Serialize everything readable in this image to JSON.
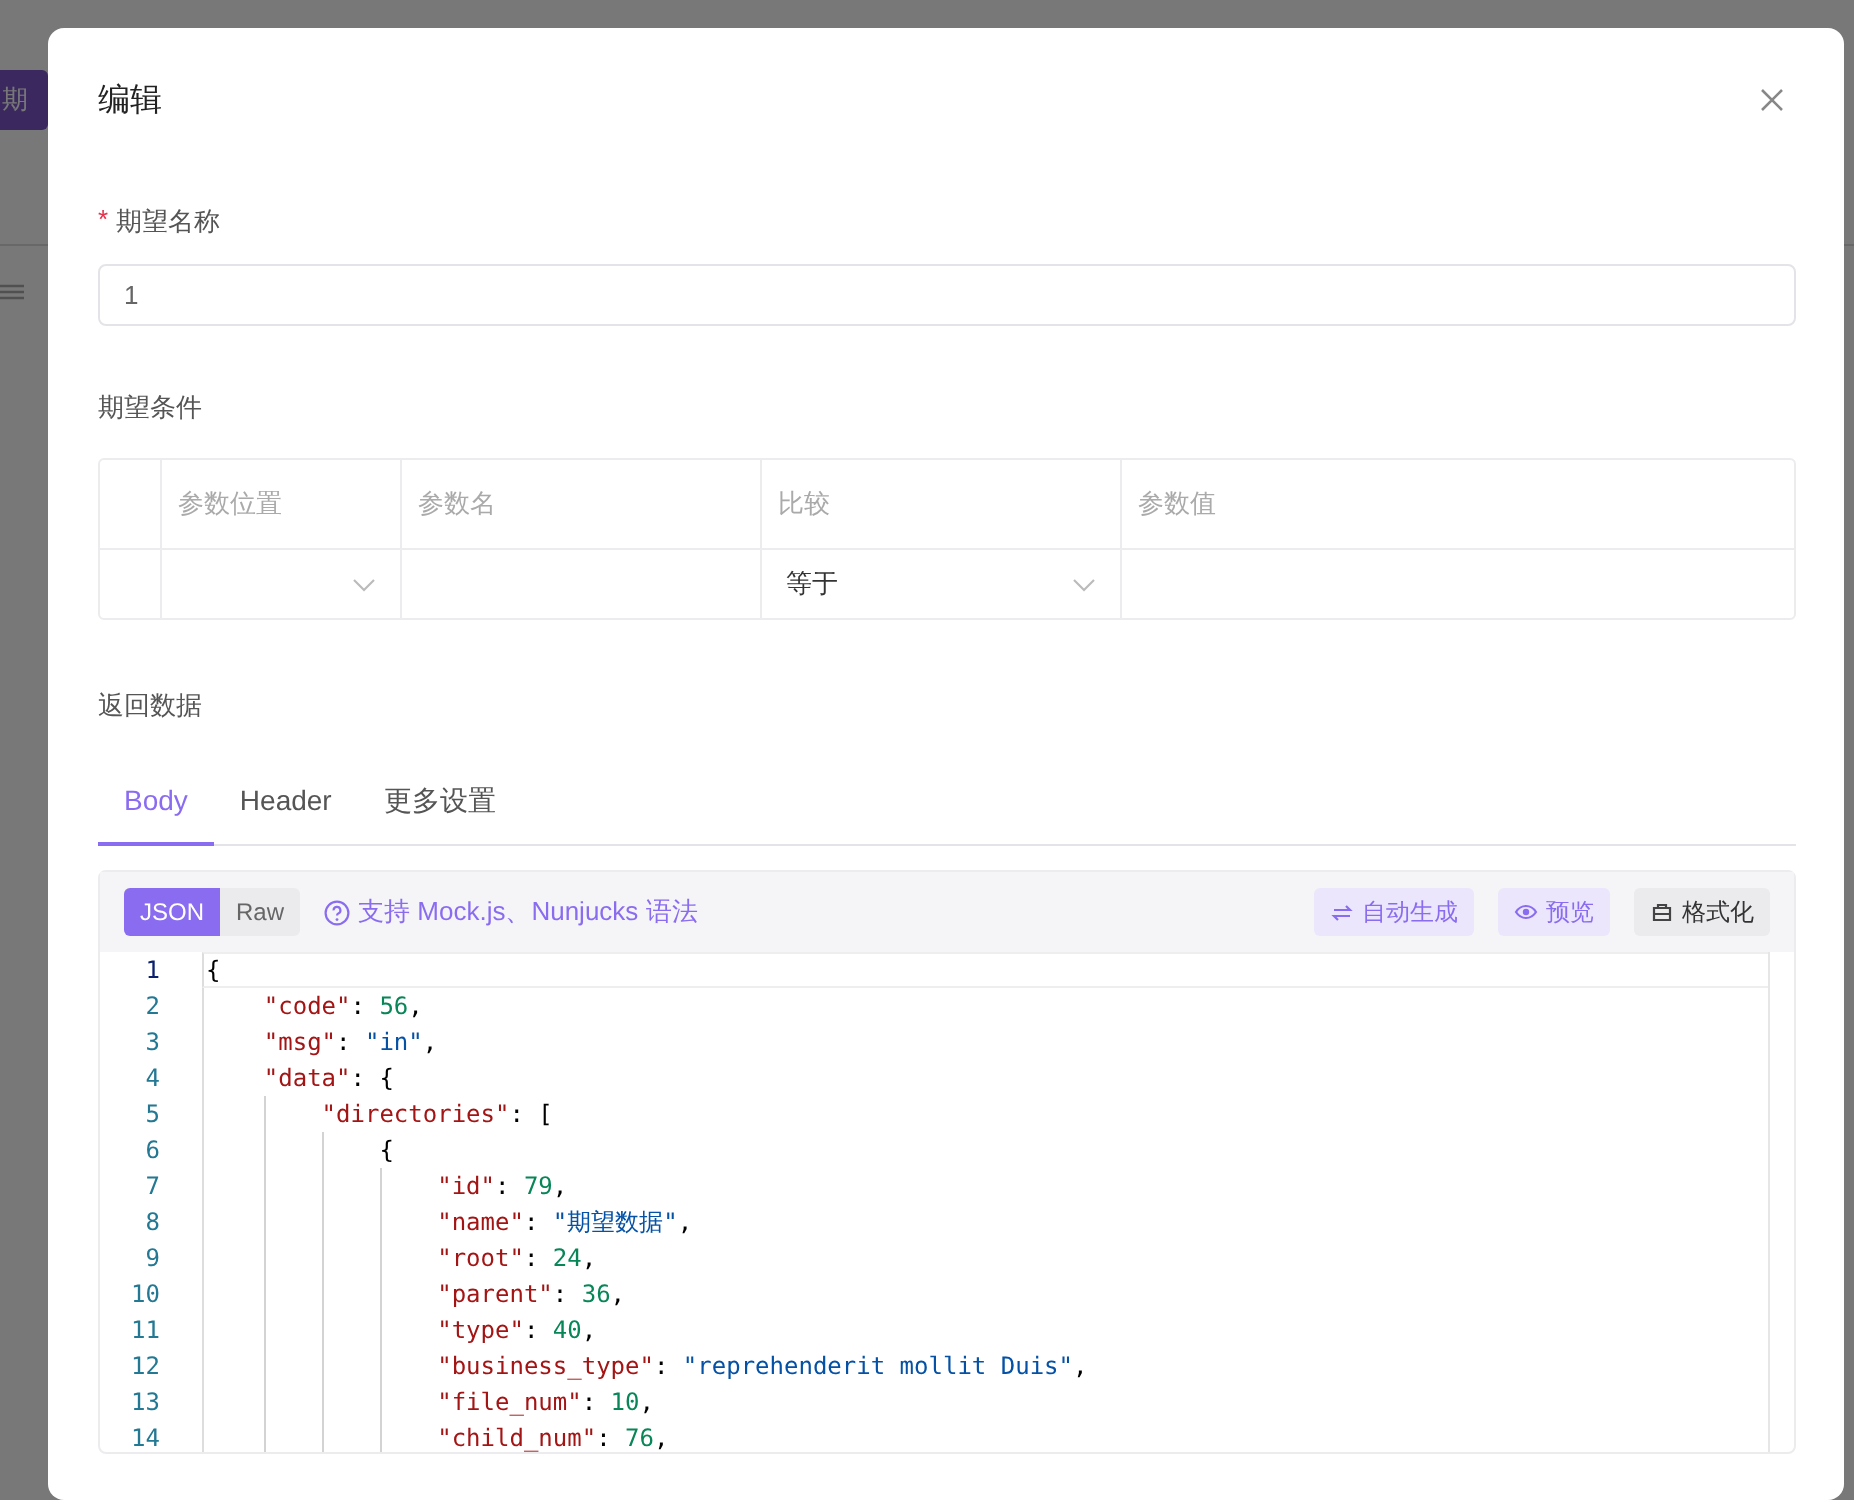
{
  "background": {
    "button_label": "期"
  },
  "dialog": {
    "title": "编辑",
    "name_field": {
      "label": "期望名称",
      "required_mark": "*",
      "value": "1"
    },
    "conditions": {
      "title": "期望条件",
      "columns": [
        "参数位置",
        "参数名",
        "比较",
        "参数值"
      ],
      "rows": [
        {
          "compare": "等于"
        }
      ]
    },
    "response": {
      "title": "返回数据",
      "tabs": [
        {
          "label": "Body",
          "selected": true
        },
        {
          "label": "Header",
          "selected": false
        },
        {
          "label": "更多设置",
          "selected": false
        }
      ],
      "formats": [
        {
          "label": "JSON",
          "selected": true
        },
        {
          "label": "Raw",
          "selected": false
        }
      ],
      "help_link": "支持 Mock.js、Nunjucks 语法",
      "actions": [
        {
          "label": "自动生成",
          "kind": "generate"
        },
        {
          "label": "预览",
          "kind": "preview"
        },
        {
          "label": "格式化",
          "kind": "format"
        }
      ],
      "code_lines": [
        {
          "number": "1",
          "current": true,
          "tokens": [
            {
              "kind": "punct",
              "text": "{"
            }
          ]
        },
        {
          "number": "2",
          "current": false,
          "tokens": [
            {
              "kind": "key",
              "text": "    \"code\""
            },
            {
              "kind": "punct",
              "text": ": "
            },
            {
              "kind": "number",
              "text": "56"
            },
            {
              "kind": "punct",
              "text": ","
            }
          ]
        },
        {
          "number": "3",
          "current": false,
          "tokens": [
            {
              "kind": "key",
              "text": "    \"msg\""
            },
            {
              "kind": "punct",
              "text": ": "
            },
            {
              "kind": "string",
              "text": "\"in\""
            },
            {
              "kind": "punct",
              "text": ","
            }
          ]
        },
        {
          "number": "4",
          "current": false,
          "tokens": [
            {
              "kind": "key",
              "text": "    \"data\""
            },
            {
              "kind": "punct",
              "text": ": {"
            }
          ]
        },
        {
          "number": "5",
          "current": false,
          "tokens": [
            {
              "kind": "key",
              "text": "        \"directories\""
            },
            {
              "kind": "punct",
              "text": ": ["
            }
          ]
        },
        {
          "number": "6",
          "current": false,
          "tokens": [
            {
              "kind": "punct",
              "text": "            {"
            }
          ]
        },
        {
          "number": "7",
          "current": false,
          "tokens": [
            {
              "kind": "key",
              "text": "                \"id\""
            },
            {
              "kind": "punct",
              "text": ": "
            },
            {
              "kind": "number",
              "text": "79"
            },
            {
              "kind": "punct",
              "text": ","
            }
          ]
        },
        {
          "number": "8",
          "current": false,
          "tokens": [
            {
              "kind": "key",
              "text": "                \"name\""
            },
            {
              "kind": "punct",
              "text": ": "
            },
            {
              "kind": "string",
              "text": "\"期望数据\""
            },
            {
              "kind": "punct",
              "text": ","
            }
          ]
        },
        {
          "number": "9",
          "current": false,
          "tokens": [
            {
              "kind": "key",
              "text": "                \"root\""
            },
            {
              "kind": "punct",
              "text": ": "
            },
            {
              "kind": "number",
              "text": "24"
            },
            {
              "kind": "punct",
              "text": ","
            }
          ]
        },
        {
          "number": "10",
          "current": false,
          "tokens": [
            {
              "kind": "key",
              "text": "                \"parent\""
            },
            {
              "kind": "punct",
              "text": ": "
            },
            {
              "kind": "number",
              "text": "36"
            },
            {
              "kind": "punct",
              "text": ","
            }
          ]
        },
        {
          "number": "11",
          "current": false,
          "tokens": [
            {
              "kind": "key",
              "text": "                \"type\""
            },
            {
              "kind": "punct",
              "text": ": "
            },
            {
              "kind": "number",
              "text": "40"
            },
            {
              "kind": "punct",
              "text": ","
            }
          ]
        },
        {
          "number": "12",
          "current": false,
          "tokens": [
            {
              "kind": "key",
              "text": "                \"business_type\""
            },
            {
              "kind": "punct",
              "text": ": "
            },
            {
              "kind": "string",
              "text": "\"reprehenderit mollit Duis\""
            },
            {
              "kind": "punct",
              "text": ","
            }
          ]
        },
        {
          "number": "13",
          "current": false,
          "tokens": [
            {
              "kind": "key",
              "text": "                \"file_num\""
            },
            {
              "kind": "punct",
              "text": ": "
            },
            {
              "kind": "number",
              "text": "10"
            },
            {
              "kind": "punct",
              "text": ","
            }
          ]
        },
        {
          "number": "14",
          "current": false,
          "tokens": [
            {
              "kind": "key",
              "text": "                \"child_num\""
            },
            {
              "kind": "punct",
              "text": ": "
            },
            {
              "kind": "number",
              "text": "76"
            },
            {
              "kind": "punct",
              "text": ","
            }
          ]
        }
      ]
    }
  }
}
